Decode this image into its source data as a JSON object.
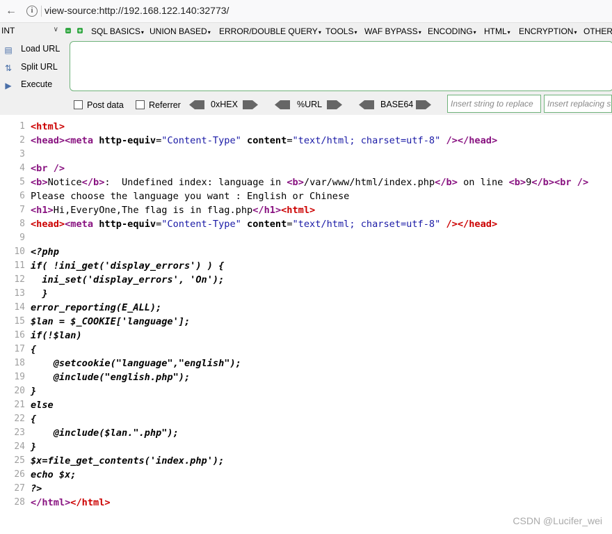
{
  "browser": {
    "url": "view-source:http://192.168.122.140:32773/"
  },
  "hackbar": {
    "select_value": "INT",
    "menus": [
      "SQL BASICS",
      "UNION BASED",
      "ERROR/DOUBLE QUERY",
      "TOOLS",
      "WAF BYPASS",
      "ENCODING",
      "HTML",
      "ENCRYPTION",
      "OTHER"
    ],
    "load_url": "Load URL",
    "split_url": "Split URL",
    "execute": "Execute",
    "post_data": "Post data",
    "referrer": "Referrer",
    "hex": "0xHEX",
    "url_enc": "%URL",
    "base64": "BASE64",
    "insert_string_placeholder": "Insert string to replace",
    "insert_replacing_placeholder": "Insert replacing string"
  },
  "source": {
    "line_numbers": [
      "1",
      "2",
      "3",
      "4",
      "5",
      "6",
      "7",
      "8",
      "9",
      "10",
      "11",
      "12",
      "13",
      "14",
      "15",
      "16",
      "17",
      "18",
      "19",
      "20",
      "21",
      "22",
      "23",
      "24",
      "25",
      "26",
      "27",
      "28"
    ],
    "l1_tag": "<html>",
    "l2_head": "<head>",
    "l2_meta_open": "<meta",
    "l2_attr1": "http-equiv",
    "l2_val1": "\"Content-Type\"",
    "l2_attr2": "content",
    "l2_val2": "\"text/html; charset=utf-8\"",
    "l2_close": "/></head>",
    "l4_br": "<br />",
    "l5_b1": "<b>",
    "l5_notice": "Notice",
    "l5_b2": "</b>",
    "l5_text1": ":  Undefined index: language in ",
    "l5_b3": "<b>",
    "l5_path": "/var/www/html/index.php",
    "l5_b4": "</b>",
    "l5_text2": " on line ",
    "l5_b5": "<b>",
    "l5_line": "9",
    "l5_b6": "</b>",
    "l5_br": "<br />",
    "l6_text": "Please choose the language you want : English or Chinese",
    "l7_h1": "<h1>",
    "l7_text": "Hi,EveryOne,The flag is in flag.php",
    "l7_h1c": "</h1>",
    "l7_html": "<html>",
    "l8_head": "<head>",
    "l8_meta_open": "<meta",
    "l8_attr1": "http-equiv",
    "l8_val1": "\"Content-Type\"",
    "l8_attr2": "content",
    "l8_val2": "\"text/html; charset=utf-8\"",
    "l8_close": "/></head>",
    "l10": "<?php",
    "l11": "if( !ini_get('display_errors') ) {",
    "l12": "  ini_set('display_errors', 'On');",
    "l13": "  }",
    "l14": "error_reporting(E_ALL);",
    "l15": "$lan = $_COOKIE['language'];",
    "l16": "if(!$lan)",
    "l17": "{",
    "l18": "    @setcookie(\"language\",\"english\");",
    "l19": "    @include(\"english.php\");",
    "l20": "}",
    "l21": "else",
    "l22": "{",
    "l23": "    @include($lan.\".php\");",
    "l24": "}",
    "l25": "$x=file_get_contents('index.php');",
    "l26": "echo $x;",
    "l27": "?>",
    "l28_a": "</html>",
    "l28_b": "</html>"
  },
  "watermark": "CSDN @Lucifer_wei"
}
